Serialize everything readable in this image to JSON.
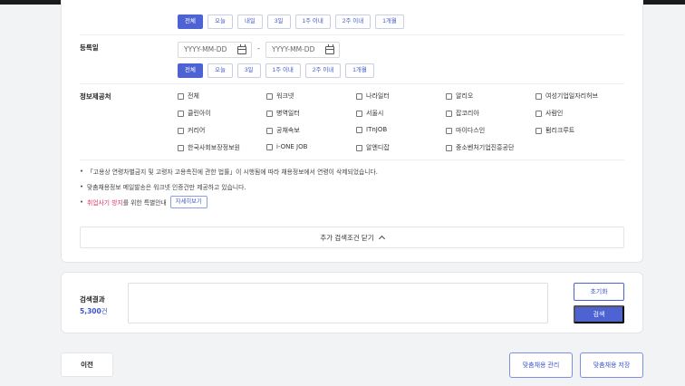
{
  "period_chips": [
    "전체",
    "오늘",
    "내일",
    "3일",
    "1주 이내",
    "2주 이내",
    "1개월"
  ],
  "register_date": {
    "label": "등록일",
    "start_placeholder": "YYYY-MM-DD",
    "separator": "-",
    "end_placeholder": "YYYY-MM-DD"
  },
  "register_chips": [
    "전체",
    "오늘",
    "3일",
    "1주 이내",
    "2주 이내",
    "1개월"
  ],
  "providers": {
    "label": "정보제공처",
    "items": [
      [
        "전체",
        "워크넷",
        "나라일터",
        "알리오",
        "여성기업일자리허브"
      ],
      [
        "클린아이",
        "병역일터",
        "서울시",
        "잡코리아",
        "사람인"
      ],
      [
        "커리어",
        "공채속보",
        "ITnJOB",
        "마이다스인",
        "펌리크루트"
      ],
      [
        "한국사회보장정보원",
        "i-ONE JOB",
        "알엔디잡",
        "중소벤처기업진흥공단"
      ]
    ]
  },
  "notes": {
    "note1": "「고용상 연령차별금지 및 고령자 고용촉진에 관한 법률」이 시행됨에 따라 채용정보에서 연령이 삭제되었습니다.",
    "note2": "맞춤채용정보 메일발송은 워크넷 인증건만 제공하고 있습니다.",
    "note3_highlight": "취업사기 방지",
    "note3_rest": "를 위한 특별안내",
    "detail_button": "자세히보기"
  },
  "collapse_label": "추가 검색조건 닫기",
  "result": {
    "label": "검색결과",
    "count": "5,300",
    "unit": "건",
    "reset_label": "초기화",
    "search_label": "검색"
  },
  "footer": {
    "prev_label": "이전",
    "manage_label": "맞춤채용 관리",
    "save_label": "맞춤채용 저장"
  },
  "colors": {
    "accent": "#4d63d4",
    "warning": "#e0335f"
  }
}
